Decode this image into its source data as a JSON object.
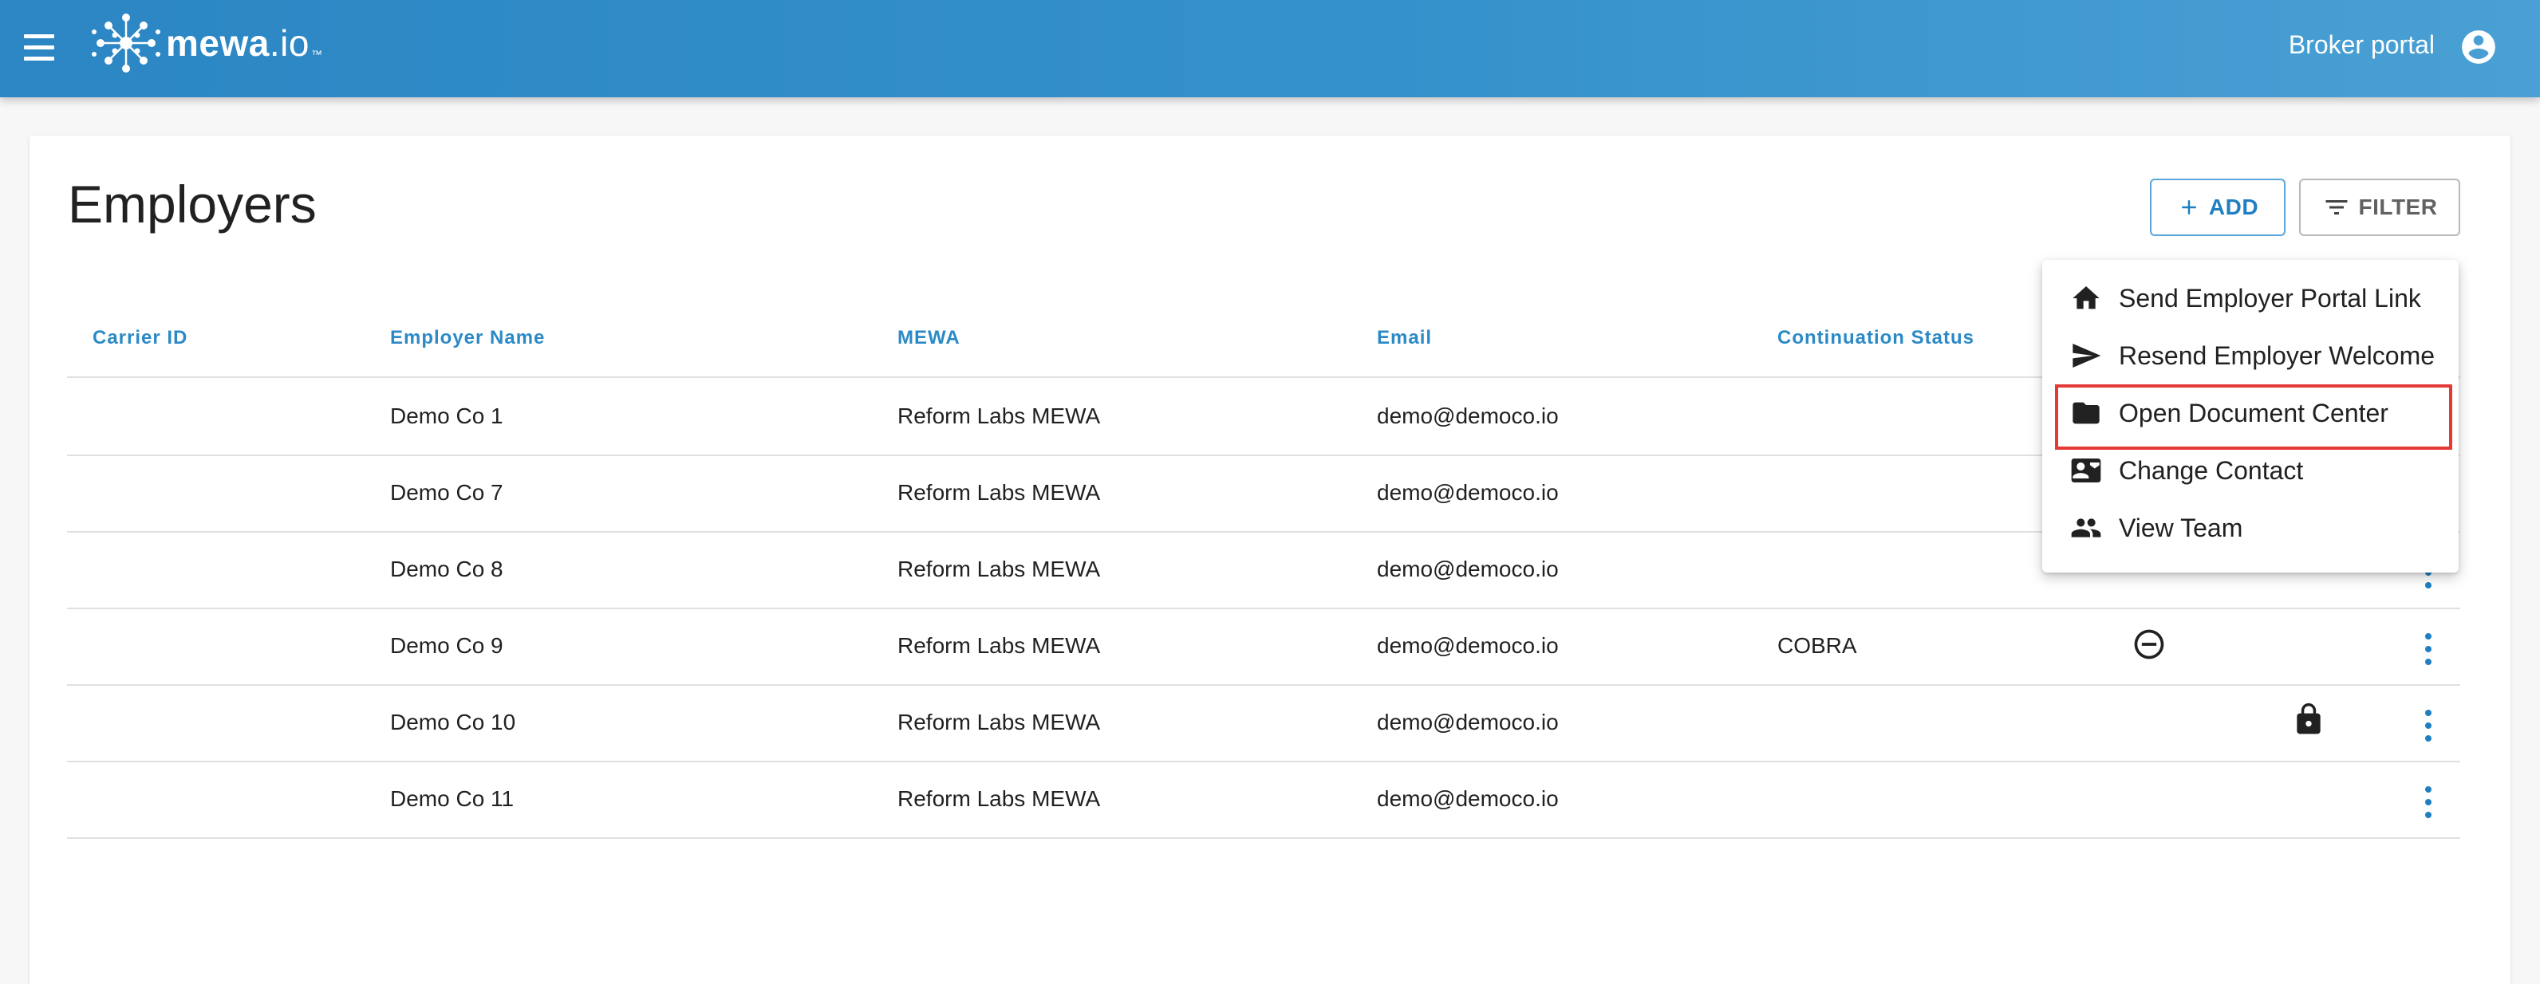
{
  "header": {
    "logo_text_bold": "mewa",
    "logo_text_light": ".io",
    "logo_tm": "™",
    "portal_label": "Broker portal"
  },
  "page": {
    "title": "Employers",
    "add_label": "ADD",
    "filter_label": "FILTER"
  },
  "table": {
    "columns": [
      "Carrier ID",
      "Employer Name",
      "MEWA",
      "Email",
      "Continuation Status"
    ],
    "rows": [
      {
        "carrier_id": "",
        "employer_name": "Demo Co 1",
        "mewa": "Reform Labs MEWA",
        "email": "demo@democo.io",
        "continuation_status": ""
      },
      {
        "carrier_id": "",
        "employer_name": "Demo Co 7",
        "mewa": "Reform Labs MEWA",
        "email": "demo@democo.io",
        "continuation_status": ""
      },
      {
        "carrier_id": "",
        "employer_name": "Demo Co 8",
        "mewa": "Reform Labs MEWA",
        "email": "demo@democo.io",
        "continuation_status": ""
      },
      {
        "carrier_id": "",
        "employer_name": "Demo Co 9",
        "mewa": "Reform Labs MEWA",
        "email": "demo@democo.io",
        "continuation_status": "COBRA",
        "status_icon": "minus-circle-icon"
      },
      {
        "carrier_id": "",
        "employer_name": "Demo Co 10",
        "mewa": "Reform Labs MEWA",
        "email": "demo@democo.io",
        "continuation_status": "",
        "status_icon": "lock-icon"
      },
      {
        "carrier_id": "",
        "employer_name": "Demo Co 11",
        "mewa": "Reform Labs MEWA",
        "email": "demo@democo.io",
        "continuation_status": ""
      }
    ]
  },
  "menu": {
    "items": [
      {
        "label": "Send Employer Portal Link",
        "icon": "home-icon"
      },
      {
        "label": "Resend Employer Welcome",
        "icon": "send-icon"
      },
      {
        "label": "Open Document Center",
        "icon": "folder-icon"
      },
      {
        "label": "Change Contact",
        "icon": "contact-card-icon"
      },
      {
        "label": "View Team",
        "icon": "people-icon"
      }
    ],
    "highlighted_item": "Open Document Center"
  },
  "colors": {
    "header_start": "#2b86c3",
    "header_end": "#4aa0d4",
    "accent": "#1f7fc1",
    "column_header": "#2b8ac6",
    "highlight": "#e53935"
  }
}
